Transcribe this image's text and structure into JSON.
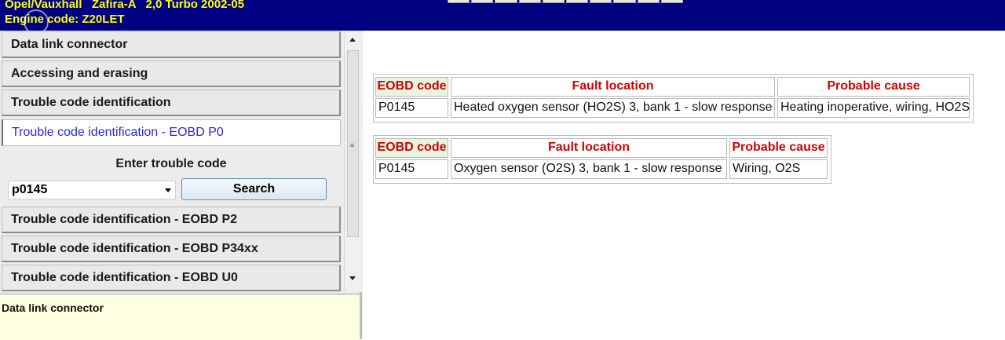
{
  "header": {
    "line1": "Opel/Vauxhall   Zafira-A   2,0 Turbo 2002-05",
    "line2": "Engine code: Z20LET"
  },
  "sidebar": {
    "items_top": [
      {
        "label": "Data link connector"
      },
      {
        "label": "Accessing and erasing"
      },
      {
        "label": "Trouble code identification"
      }
    ],
    "active_item": {
      "label": "Trouble code identification - EOBD P0"
    },
    "search_panel": {
      "title": "Enter trouble code",
      "code_value": "p0145",
      "search_label": "Search"
    },
    "items_bottom": [
      {
        "label": "Trouble code identification - EOBD P2"
      },
      {
        "label": "Trouble code identification - EOBD P34xx"
      },
      {
        "label": "Trouble code identification - EOBD U0"
      }
    ]
  },
  "info_panel": {
    "text": "Data link connector"
  },
  "tables": [
    {
      "headers": [
        "EOBD code",
        "Fault location",
        "Probable cause"
      ],
      "rows": [
        [
          "P0145",
          "Heated oxygen sensor (HO2S) 3, bank 1 - slow response",
          "Heating inoperative, wiring, HO2S"
        ]
      ]
    },
    {
      "headers": [
        "EOBD code",
        "Fault location",
        "Probable cause"
      ],
      "rows": [
        [
          "P0145",
          "Oxygen sensor (O2S) 3, bank 1 - slow response",
          "Wiring, O2S"
        ]
      ]
    }
  ],
  "colors": {
    "header_bg": "#000080",
    "header_text": "#ffff00",
    "table_header_text": "#d40000",
    "table_code_header_bg": "#e7f5e1",
    "active_item_text": "#2a2acc",
    "info_bg": "#ffffe1"
  }
}
